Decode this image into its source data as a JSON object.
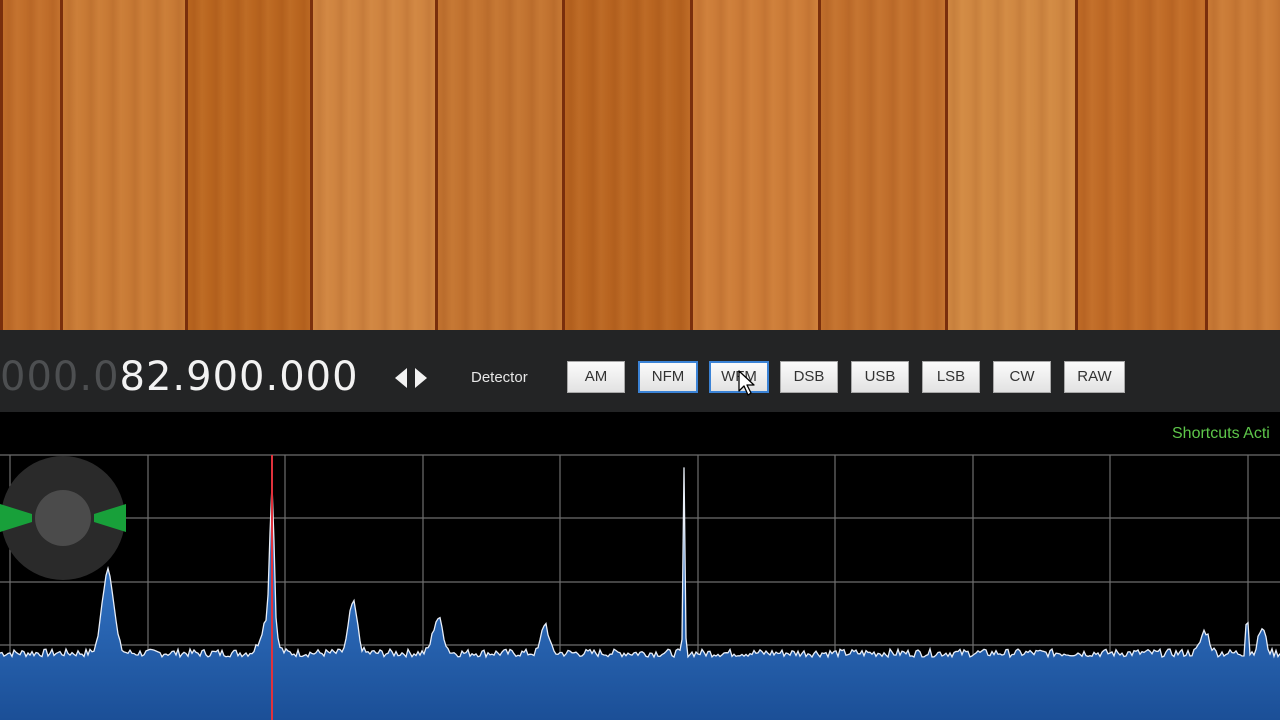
{
  "frequency": {
    "dim_part": "000.0",
    "bright_part": "82.900.000"
  },
  "detector": {
    "label": "Detector",
    "modes": [
      "AM",
      "NFM",
      "WFM",
      "DSB",
      "USB",
      "LSB",
      "CW",
      "RAW"
    ],
    "active_modes": [
      "NFM",
      "WFM"
    ]
  },
  "status": {
    "shortcuts_text": "Shortcuts Acti"
  },
  "colors": {
    "toolbar_bg": "#232425",
    "active_border": "#3b83d6",
    "spectrum_fill": "#2f6fbf",
    "spectrum_line": "#e8eef8",
    "tuning_marker": "#e0323c",
    "shortcuts_green": "#5ec64a",
    "jog_green": "#18a03a"
  },
  "icons": {
    "freq_step": "left-right-arrows-icon",
    "cursor": "mouse-pointer-icon",
    "jog": "tuning-jog-wheel-icon"
  }
}
